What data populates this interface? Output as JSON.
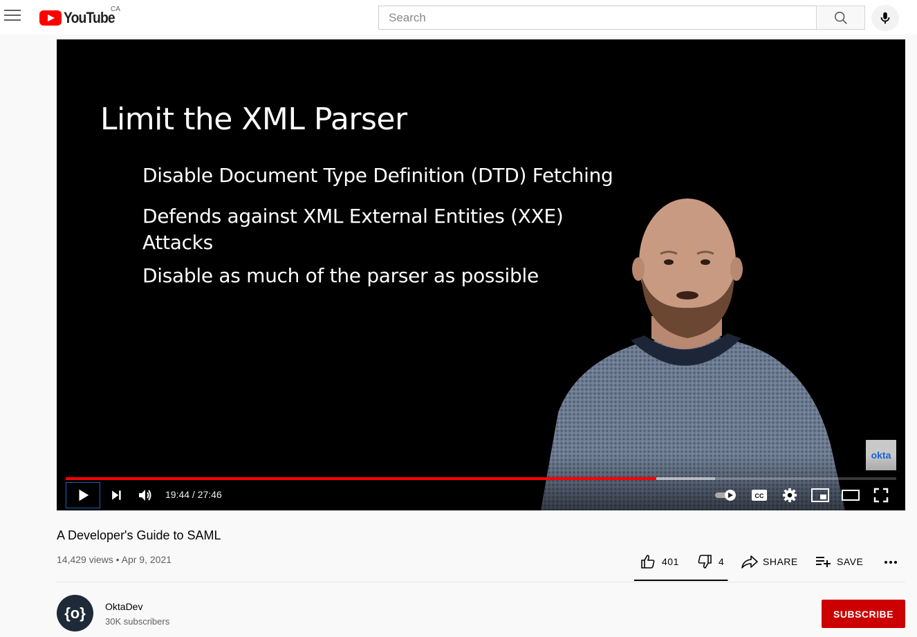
{
  "masthead": {
    "logo_text": "YouTube",
    "country_code": "CA",
    "search_placeholder": "Search",
    "icons": [
      "menu-icon",
      "search-icon",
      "microphone-icon"
    ]
  },
  "player": {
    "slide": {
      "title": "Limit the XML Parser",
      "bullets": [
        "Disable Document Type Definition (DTD) Fetching",
        "Defends against XML External Entities (XXE)",
        "Attacks",
        "Disable as much of the parser as possible"
      ]
    },
    "watermark": "okta",
    "current_time": "19:44",
    "duration": "27:46",
    "time_display": "19:44 / 27:46",
    "progress_fraction": 0.711,
    "buffered_fraction": 0.782,
    "controls": [
      "play-icon",
      "next-icon",
      "volume-icon",
      "autoplay-toggle",
      "captions-icon",
      "settings-icon",
      "miniplayer-icon",
      "theater-icon",
      "fullscreen-icon"
    ]
  },
  "video": {
    "title": "A Developer's Guide to SAML",
    "views": "14,429 views",
    "date": "Apr 9, 2021",
    "meta_line": "14,429 views • Apr 9, 2021",
    "likes": "401",
    "dislikes": "4",
    "share_label": "SHARE",
    "save_label": "SAVE",
    "like_fraction": 0.99
  },
  "channel": {
    "name": "OktaDev",
    "subscribers": "30K subscribers",
    "avatar_text": "{o}",
    "subscribe_label": "SUBSCRIBE"
  },
  "colors": {
    "brand_red": "#ff0000",
    "subscribe_red": "#cc0000",
    "text_primary": "#030303",
    "text_secondary": "#606060"
  }
}
